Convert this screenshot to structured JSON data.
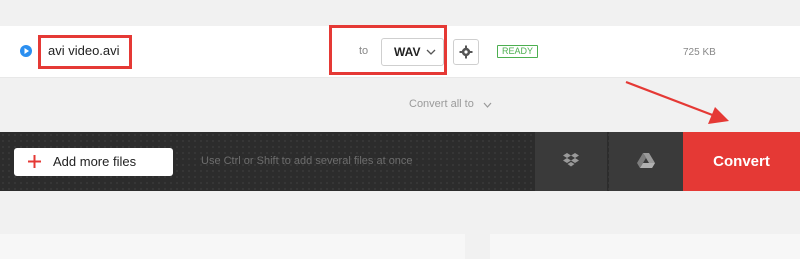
{
  "file": {
    "name": "avi video.avi",
    "to_label": "to",
    "format": "WAV",
    "status": "READY",
    "size": "725 KB"
  },
  "convert_all": {
    "label": "Convert all to"
  },
  "toolbar": {
    "add_files_label": "Add more files",
    "hint": "Use Ctrl or Shift to add several files at once",
    "convert_label": "Convert"
  },
  "colors": {
    "accent_red": "#e53935",
    "toolbar_bg": "#2c2c2c",
    "status_green": "#4caf50",
    "play_blue": "#2b8ff0"
  },
  "icons": {
    "play": "play-icon",
    "dropdown": "chevron-down-icon",
    "settings": "gear-icon",
    "add": "plus-icon",
    "dropbox": "dropbox-icon",
    "google_drive": "google-drive-icon"
  }
}
